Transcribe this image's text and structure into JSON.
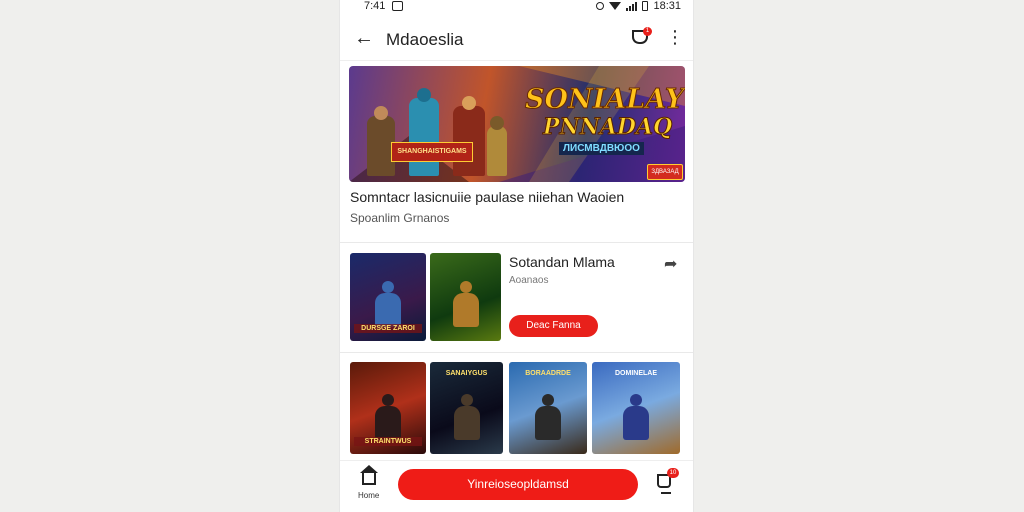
{
  "status_bar": {
    "time": "7:41",
    "clock_right": "18:31"
  },
  "app_bar": {
    "title": "Mdaoeslia",
    "cart_badge": "1"
  },
  "banner": {
    "headline": "SONIALAY",
    "subheadline": "PNNADAQ",
    "tagline": "ЛИСМВДВЮОО",
    "logo_text": "SHANGHAISTIGAMS",
    "badge_text": "ЗДВАЗАД"
  },
  "featured": {
    "title": "Somntacr lasicnuiie paulase niiehan Waoien",
    "subtitle": "Spoanlim Grnanos"
  },
  "game": {
    "thumb1_label": "DURSGE ZAROI",
    "title": "Sotandan Mlama",
    "subtitle": "Aoanaos",
    "button_label": "Deac Fanna"
  },
  "gallery": [
    {
      "label": "STRAINTWUS",
      "position": "bottom"
    },
    {
      "label": "SANAIYGUS",
      "position": "top"
    },
    {
      "label": "BORAADRDE",
      "position": "top"
    },
    {
      "label": "DOMINELAE",
      "position": "top"
    }
  ],
  "bottom_bar": {
    "home_label": "Home",
    "cta_label": "Yinreioseopldamsd",
    "cart_badge": "10"
  }
}
